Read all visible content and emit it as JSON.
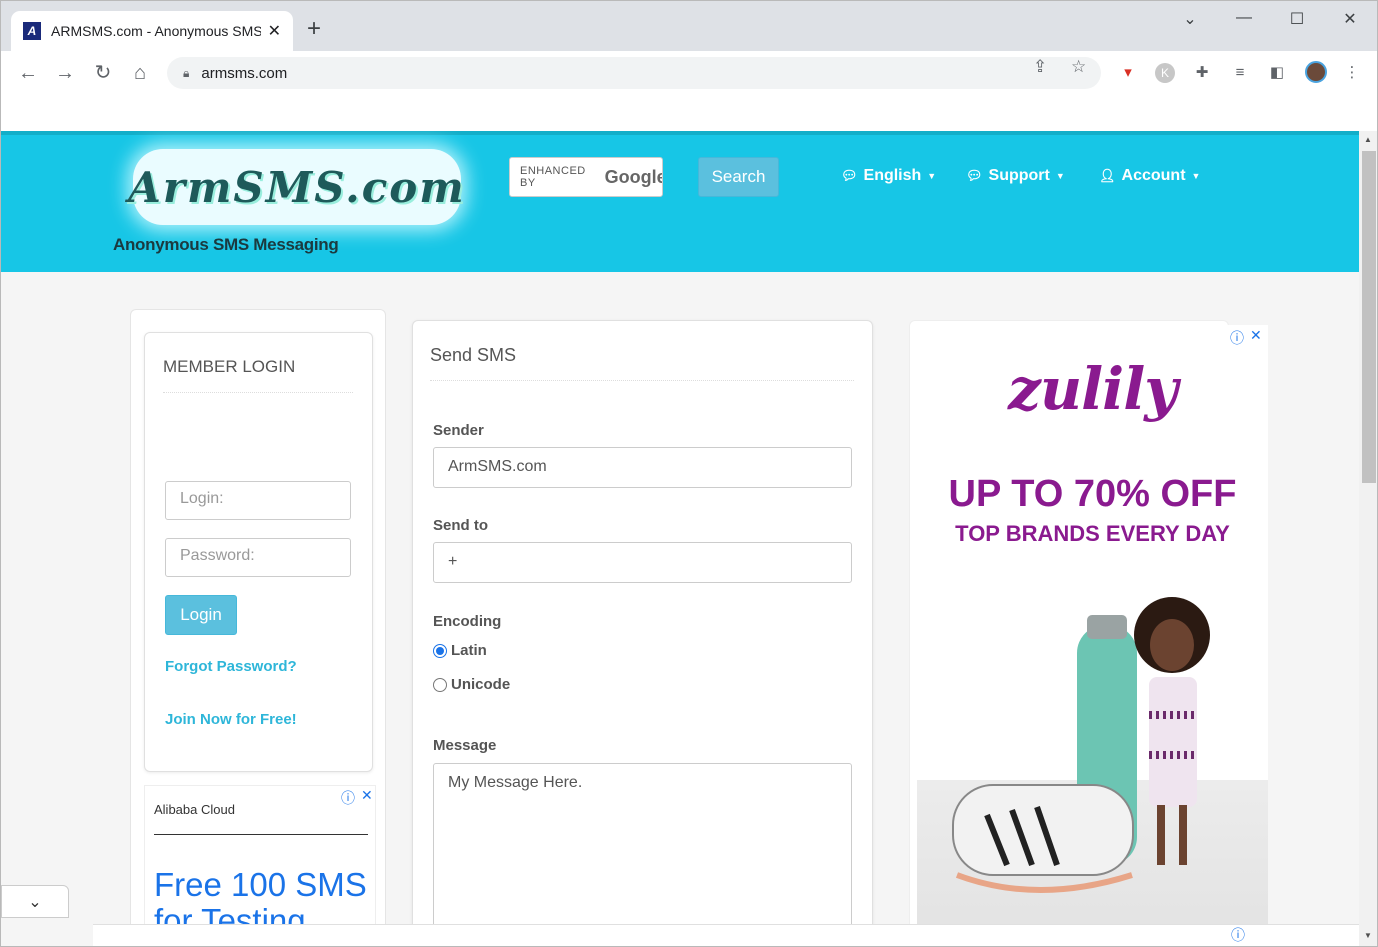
{
  "browser": {
    "tab_title": "ARMSMS.com - Anonymous SMS",
    "tab_close": "✕",
    "new_tab": "+",
    "url": "armsms.com",
    "window_controls": [
      "⌄",
      "—",
      "☐",
      "✕"
    ]
  },
  "header": {
    "logo_text": "ArmSMS.com",
    "tagline": "Anonymous SMS Messaging",
    "search_enhanced": "ENHANCED BY",
    "search_google": "Google",
    "search_button": "Search",
    "nav": [
      {
        "label": "English",
        "icon": "chat-icon"
      },
      {
        "label": "Support",
        "icon": "chat-icon"
      },
      {
        "label": "Account",
        "icon": "user-icon"
      }
    ]
  },
  "login": {
    "title": "MEMBER LOGIN",
    "login_placeholder": "Login:",
    "password_placeholder": "Password:",
    "login_button": "Login",
    "forgot": "Forgot Password?",
    "join": "Join Now for Free!"
  },
  "left_ad": {
    "brand": "Alibaba Cloud",
    "headline": "Free 100 SMS",
    "headline2": "for Testing"
  },
  "send_sms": {
    "title": "Send SMS",
    "sender_label": "Sender",
    "sender_value": "ArmSMS.com",
    "sendto_label": "Send to",
    "sendto_value": "+",
    "encoding_label": "Encoding",
    "encoding_options": [
      "Latin",
      "Unicode"
    ],
    "encoding_selected": "Latin",
    "message_label": "Message",
    "message_value": "My Message Here."
  },
  "right_ad": {
    "brand": "zulily",
    "offer": "UP TO 70% OFF",
    "sub": "TOP BRANDS EVERY DAY"
  },
  "colors": {
    "header_bg": "#17c6e6",
    "button_bg": "#5bc0de",
    "link": "#2eb6d9",
    "ad_purple": "#8a1a8f"
  }
}
